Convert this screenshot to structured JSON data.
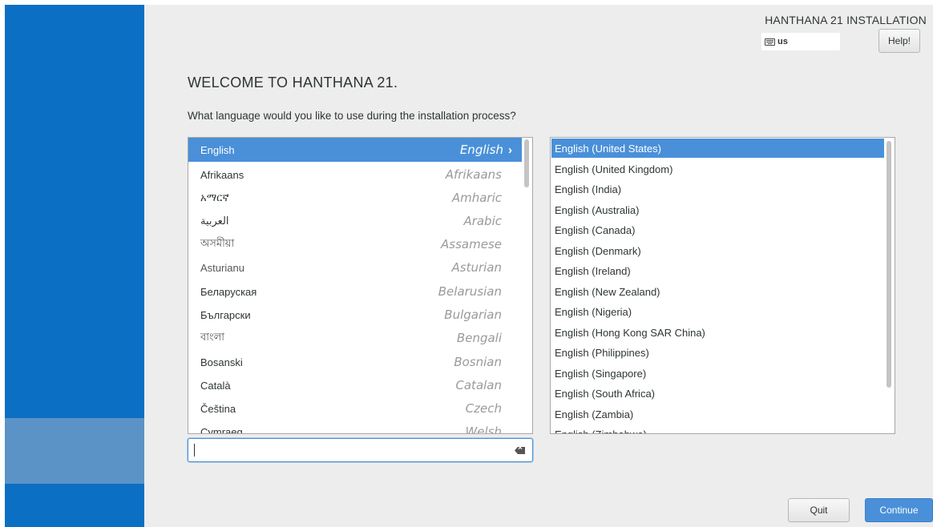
{
  "header": {
    "install_title": "HANTHANA 21 INSTALLATION",
    "keyboard_layout": "us",
    "help_label": "Help!"
  },
  "welcome": {
    "heading": "WELCOME TO HANTHANA 21.",
    "question": "What language would you like to use during the installation process?"
  },
  "languages": [
    {
      "native": "English",
      "english": "English",
      "selected": true
    },
    {
      "native": "Afrikaans",
      "english": "Afrikaans"
    },
    {
      "native": "አማርኛ",
      "english": "Amharic"
    },
    {
      "native": "العربية",
      "english": "Arabic"
    },
    {
      "native": "অসমীয়া",
      "english": "Assamese"
    },
    {
      "native": "Asturianu",
      "english": "Asturian"
    },
    {
      "native": "Беларуская",
      "english": "Belarusian"
    },
    {
      "native": "Български",
      "english": "Bulgarian"
    },
    {
      "native": "বাংলা",
      "english": "Bengali"
    },
    {
      "native": "Bosanski",
      "english": "Bosnian"
    },
    {
      "native": "Català",
      "english": "Catalan"
    },
    {
      "native": "Čeština",
      "english": "Czech"
    },
    {
      "native": "Cymraeg",
      "english": "Welsh"
    }
  ],
  "locales": [
    {
      "label": "English (United States)",
      "selected": true
    },
    {
      "label": "English (United Kingdom)"
    },
    {
      "label": "English (India)"
    },
    {
      "label": "English (Australia)"
    },
    {
      "label": "English (Canada)"
    },
    {
      "label": "English (Denmark)"
    },
    {
      "label": "English (Ireland)"
    },
    {
      "label": "English (New Zealand)"
    },
    {
      "label": "English (Nigeria)"
    },
    {
      "label": "English (Hong Kong SAR China)"
    },
    {
      "label": "English (Philippines)"
    },
    {
      "label": "English (Singapore)"
    },
    {
      "label": "English (South Africa)"
    },
    {
      "label": "English (Zambia)"
    },
    {
      "label": "English (Zimbabwe)"
    }
  ],
  "search": {
    "value": ""
  },
  "footer": {
    "quit_label": "Quit",
    "continue_label": "Continue"
  },
  "colors": {
    "sidebar": "#0b6fc4",
    "selection": "#4a90d9",
    "background": "#ededed"
  }
}
